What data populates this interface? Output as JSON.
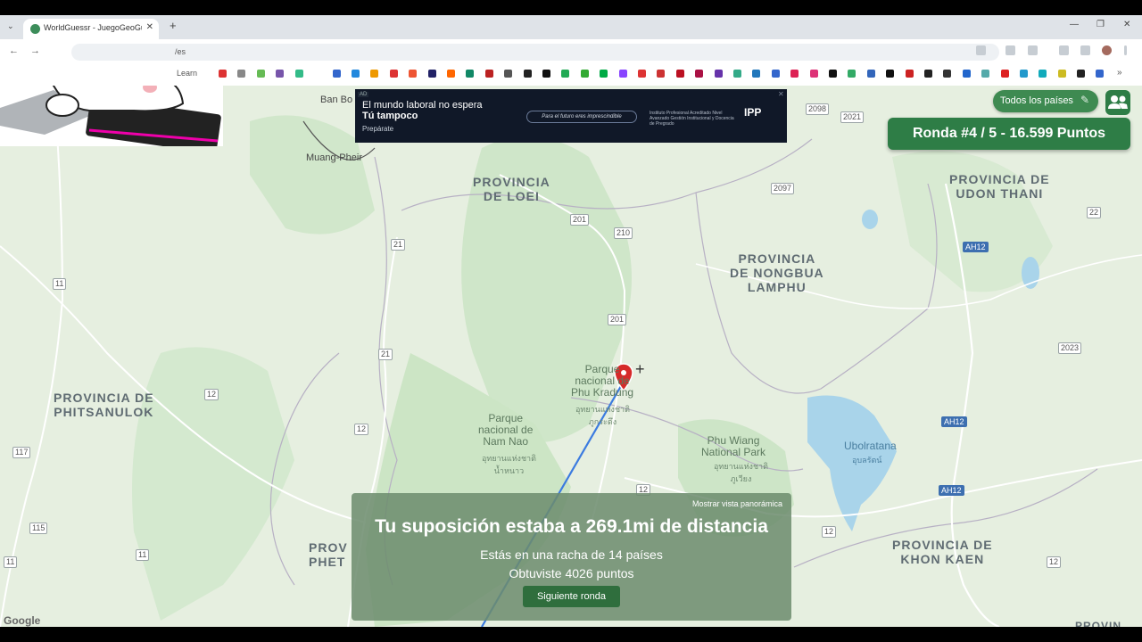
{
  "browser": {
    "tab_title": "WorldGuessr - JuegoGeoGuessr",
    "url": "/es",
    "bookmark_folder": "Learn",
    "new_tab": "+",
    "tab_close": "✕",
    "tab_list": "⌄",
    "back": "←",
    "forward": "→",
    "minimize": "—",
    "maximize": "❐",
    "close_window": "✕",
    "bookmarks_more": "»"
  },
  "ad": {
    "tag": "AD",
    "line1": "El mundo laboral no espera",
    "line2": "Tú tampoco",
    "line3": "Prepárate",
    "pill": "Para el futuro eres imprescindible",
    "org": "Instituto Profesional Acreditado Nivel Avanzado Gestión Institucional y Docencia de Pregrado",
    "logo": "IPP",
    "close": "✕"
  },
  "map": {
    "provinces": [
      {
        "name": "PROVINCIA\nDE LOEI"
      },
      {
        "name": "PROVINCIA DE\nUDON THANI"
      },
      {
        "name": "PROVINCIA\nDE NONGBUA\nLAMPHU"
      },
      {
        "name": "PROVINCIA DE\nPHITSANULOK"
      },
      {
        "name": "PROVINCIA DE\nKHON KAEN"
      },
      {
        "name": "PROV\nPHET"
      },
      {
        "name": "PROVIN"
      }
    ],
    "parks": [
      {
        "name": "Parque\nnacional de\nPhu Kradung",
        "thai": "อุทยานแห่งชาติ\nภูกระดึง"
      },
      {
        "name": "Parque\nnacional de\nNam Nao",
        "thai": "อุทยานแห่งชาติ\nน้ำหนาว"
      },
      {
        "name": "Phu Wiang\nNational Park",
        "thai": "อุทยานแห่งชาติ\nภูเวียง"
      }
    ],
    "water": [
      {
        "name": "Ubolratana",
        "thai": "อุบลรัตน์"
      }
    ],
    "towns": [
      "Ban Bo",
      "Muang-Pheir"
    ],
    "route_shields": [
      "201",
      "210",
      "201",
      "21",
      "21",
      "11",
      "12",
      "12",
      "117",
      "115",
      "11",
      "11",
      "12",
      "2097",
      "2098",
      "2021",
      "22",
      "2023",
      "12",
      "12"
    ],
    "ah_shields": [
      "AH12",
      "AH12",
      "AH12"
    ],
    "google": "Google"
  },
  "game": {
    "country_filter": "Todos los países",
    "edit_icon": "✎",
    "round": "Ronda #4 / 5 - 16.599 Puntos",
    "panorama": "Mostrar vista panorámica",
    "distance": "Tu suposición estaba a 269.1mi de distancia",
    "streak": "Estás en una racha de 14 países",
    "points": "Obtuviste 4026 puntos",
    "next": "Siguiente ronda"
  }
}
